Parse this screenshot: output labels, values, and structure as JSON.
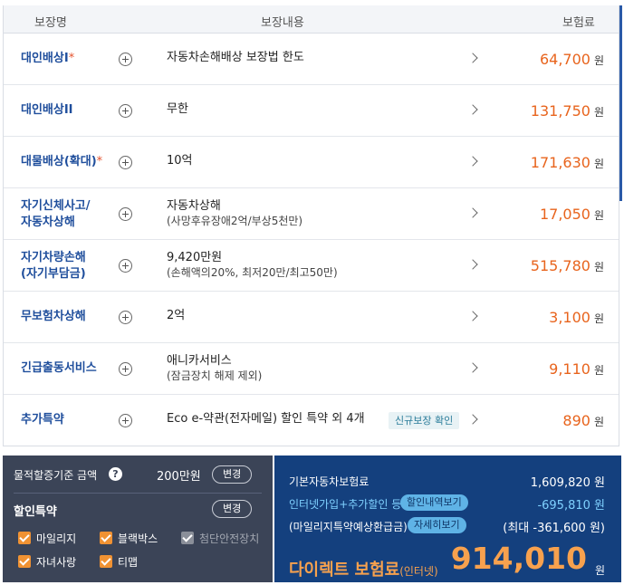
{
  "table": {
    "headers": {
      "name": "보장명",
      "content": "보장내용",
      "premium": "보험료"
    },
    "rows": [
      {
        "name1": "대인배상I",
        "star": "*",
        "name2": "",
        "content": "자동차손해배상 보장법 한도",
        "sub": "",
        "premium": "64,700",
        "unit": "원"
      },
      {
        "name1": "대인배상II",
        "star": "",
        "name2": "",
        "content": "무한",
        "sub": "",
        "premium": "131,750",
        "unit": "원"
      },
      {
        "name1": "대물배상(확대)",
        "star": "*",
        "name2": "",
        "content": "10억",
        "sub": "",
        "premium": "171,630",
        "unit": "원"
      },
      {
        "name1": "자기신체사고/",
        "star": "",
        "name2": "자동차상해",
        "content": "자동차상해",
        "sub": "(사망후유장애2억/부상5천만)",
        "premium": "17,050",
        "unit": "원"
      },
      {
        "name1": "자기차량손해",
        "star": "",
        "name2": "(자기부담금)",
        "content": "9,420만원",
        "sub": "(손해액의20%, 최저20만/최고50만)",
        "premium": "515,780",
        "unit": "원"
      },
      {
        "name1": "무보험차상해",
        "star": "",
        "name2": "",
        "content": "2억",
        "sub": "",
        "premium": "3,100",
        "unit": "원"
      },
      {
        "name1": "긴급출동서비스",
        "star": "",
        "name2": "",
        "content": "애니카서비스",
        "sub": "(잠금장치 해제 제외)",
        "premium": "9,110",
        "unit": "원"
      },
      {
        "name1": "추가특약",
        "star": "",
        "name2": "",
        "content": "Eco e-약관(전자메일) 할인 특약 외 4개",
        "sub": "",
        "premium": "890",
        "unit": "원",
        "badge": "신규보장 확인"
      }
    ]
  },
  "left_panel": {
    "property_label": "물적할증기준 금액",
    "help_icon": "?",
    "property_amount": "200만원",
    "change_btn1": "변경",
    "discount_label": "할인특약",
    "change_btn2": "변경",
    "checkboxes": [
      {
        "label": "마일리지",
        "checked": true,
        "disabled": false
      },
      {
        "label": "블랙박스",
        "checked": true,
        "disabled": false
      },
      {
        "label": "첨단안전장치",
        "checked": true,
        "disabled": true
      },
      {
        "label": "자녀사랑",
        "checked": true,
        "disabled": false
      },
      {
        "label": "티맵",
        "checked": true,
        "disabled": false
      }
    ]
  },
  "right_panel": {
    "base_label": "기본자동차보험료",
    "base_value": "1,609,820 원",
    "discount_label": "인터넷가입+추가할인 등",
    "discount_pill": "할인내역보기",
    "discount_value": "-695,810 원",
    "mileage_label": "(마일리지특약예상환급금)",
    "mileage_pill": "자세히보기",
    "mileage_value": "(최대 -361,600 원)",
    "final_label": "다이렉트 보험료",
    "final_suffix": "(인터넷)",
    "final_value": "914,010",
    "final_unit": "원"
  },
  "colors": {
    "accent_orange": "#e8641d",
    "name_blue": "#1f4e9c",
    "panel_left": "#3b4457",
    "panel_right": "#14407e"
  },
  "icons": {
    "expand": "plus-circle-icon",
    "detail": "chevron-right-icon",
    "check": "checkbox-icon"
  }
}
